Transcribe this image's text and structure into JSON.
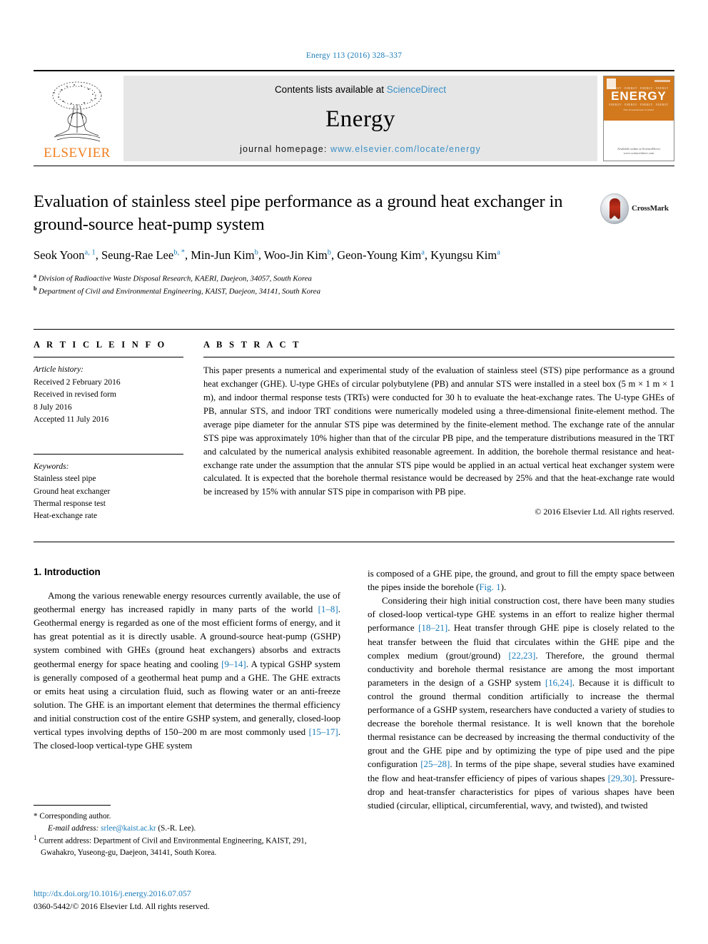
{
  "running_head": "Energy 113 (2016) 328–337",
  "masthead": {
    "publisher": "ELSEVIER",
    "contents_prefix": "Contents lists available at ",
    "sciencedirect": "ScienceDirect",
    "journal_title": "Energy",
    "homepage_label": "journal homepage: ",
    "homepage_url": "www.elsevier.com/locate/energy",
    "cover": {
      "title": "ENERGY",
      "subtitle": "The International Journal",
      "strip": "ENERGY  ·  ENERGY  ·  ENERGY  ·  ENERGY",
      "bottom": "Available online at\nScienceDirect\nwww.sciencedirect.com"
    }
  },
  "article": {
    "title": "Evaluation of stainless steel pipe performance as a ground heat exchanger in ground-source heat-pump system",
    "crossmark_label": "CrossMark",
    "authors": [
      {
        "name": "Seok Yoon",
        "marks": "a, 1",
        "sep": ", "
      },
      {
        "name": "Seung-Rae Lee",
        "marks": "b, *",
        "sep": ", "
      },
      {
        "name": "Min-Jun Kim",
        "marks": "b",
        "sep": ", "
      },
      {
        "name": "Woo-Jin Kim",
        "marks": "b",
        "sep": ", "
      },
      {
        "name": "Geon-Young Kim",
        "marks": "a",
        "sep": ", "
      },
      {
        "name": "Kyungsu Kim",
        "marks": "a",
        "sep": ""
      }
    ],
    "affiliations": [
      {
        "mark": "a",
        "text": "Division of Radioactive Waste Disposal Research, KAERI, Daejeon, 34057, South Korea"
      },
      {
        "mark": "b",
        "text": "Department of Civil and Environmental Engineering, KAIST, Daejeon, 34141, South Korea"
      }
    ]
  },
  "article_info": {
    "heading": "A R T I C L E  I N F O",
    "history_label": "Article history:",
    "history": [
      "Received 2 February 2016",
      "Received in revised form",
      "8 July 2016",
      "Accepted 11 July 2016"
    ],
    "keywords_label": "Keywords:",
    "keywords": [
      "Stainless steel pipe",
      "Ground heat exchanger",
      "Thermal response test",
      "Heat-exchange rate"
    ]
  },
  "abstract": {
    "heading": "A B S T R A C T",
    "text": "This paper presents a numerical and experimental study of the evaluation of stainless steel (STS) pipe performance as a ground heat exchanger (GHE). U-type GHEs of circular polybutylene (PB) and annular STS were installed in a steel box (5 m × 1 m × 1 m), and indoor thermal response tests (TRTs) were conducted for 30 h to evaluate the heat-exchange rates. The U-type GHEs of PB, annular STS, and indoor TRT conditions were numerically modeled using a three-dimensional finite-element method. The average pipe diameter for the annular STS pipe was determined by the finite-element method. The exchange rate of the annular STS pipe was approximately 10% higher than that of the circular PB pipe, and the temperature distributions measured in the TRT and calculated by the numerical analysis exhibited reasonable agreement. In addition, the borehole thermal resistance and heat-exchange rate under the assumption that the annular STS pipe would be applied in an actual vertical heat exchanger system were calculated. It is expected that the borehole thermal resistance would be decreased by 25% and that the heat-exchange rate would be increased by 15% with annular STS pipe in comparison with PB pipe.",
    "copyright": "© 2016 Elsevier Ltd. All rights reserved."
  },
  "introduction": {
    "heading": "1. Introduction",
    "left_paragraph_1_a": "Among the various renewable energy resources currently available, the use of geothermal energy has increased rapidly in many parts of the world ",
    "cite_1_8": "[1–8]",
    "left_paragraph_1_b": ". Geothermal energy is regarded as one of the most efficient forms of energy, and it has great potential as it is directly usable. A ground-source heat-pump (GSHP) system combined with GHEs (ground heat exchangers) absorbs and extracts geothermal energy for space heating and cooling ",
    "cite_9_14": "[9–14]",
    "left_paragraph_1_c": ". A typical GSHP system is generally composed of a geothermal heat pump and a GHE. The GHE extracts or emits heat using a circulation fluid, such as flowing water or an anti-freeze solution. The GHE is an important element that determines the thermal efficiency and initial construction cost of the entire GSHP system, and generally, closed-loop vertical types involving depths of 150–200 m are most commonly used ",
    "cite_15_17": "[15–17]",
    "left_paragraph_1_d": ". The closed-loop vertical-type GHE system",
    "right_paragraph_1_a": "is composed of a GHE pipe, the ground, and grout to fill the empty space between the pipes inside the borehole (",
    "fig_ref": "Fig. 1",
    "right_paragraph_1_b": ").",
    "right_paragraph_2_a": "Considering their high initial construction cost, there have been many studies of closed-loop vertical-type GHE systems in an effort to realize higher thermal performance ",
    "cite_18_21": "[18–21]",
    "right_paragraph_2_b": ". Heat transfer through GHE pipe is closely related to the heat transfer between the fluid that circulates within the GHE pipe and the complex medium (grout/ground) ",
    "cite_22_23": "[22,23]",
    "right_paragraph_2_c": ". Therefore, the ground thermal conductivity and borehole thermal resistance are among the most important parameters in the design of a GSHP system ",
    "cite_16_24": "[16,24]",
    "right_paragraph_2_d": ". Because it is difficult to control the ground thermal condition artificially to increase the thermal performance of a GSHP system, researchers have conducted a variety of studies to decrease the borehole thermal resistance. It is well known that the borehole thermal resistance can be decreased by increasing the thermal conductivity of the grout and the GHE pipe and by optimizing the type of pipe used and the pipe configuration ",
    "cite_25_28": "[25–28]",
    "right_paragraph_2_e": ". In terms of the pipe shape, several studies have examined the flow and heat-transfer efficiency of pipes of various shapes ",
    "cite_29_30": "[29,30]",
    "right_paragraph_2_f": ". Pressure-drop and heat-transfer characteristics for pipes of various shapes have been studied (circular, elliptical, circumferential, wavy, and twisted), and twisted"
  },
  "footnotes": {
    "corresponding_marker": "*",
    "corresponding_text": "Corresponding author.",
    "email_label": "E-mail address:",
    "email": "srlee@kaist.ac.kr",
    "email_suffix": "(S.-R. Lee).",
    "current_marker": "1",
    "current_text": "Current address: Department of Civil and Environmental Engineering, KAIST, 291, Gwahakro, Yuseong-gu, Daejeon, 34141, South Korea."
  },
  "doi_block": {
    "doi": "http://dx.doi.org/10.1016/j.energy.2016.07.057",
    "issn_line": "0360-5442/© 2016 Elsevier Ltd. All rights reserved."
  },
  "colors": {
    "link_blue": "#1a7bb9",
    "elsevier_orange": "#f07f20",
    "banner_gray": "#e6e6e6",
    "cover_orange": "#d2791e"
  }
}
